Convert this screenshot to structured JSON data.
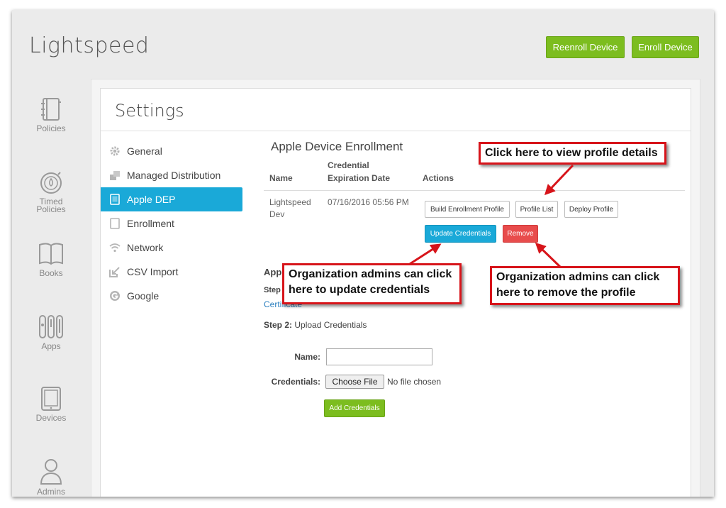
{
  "app": {
    "title": "Lightspeed"
  },
  "header": {
    "reenroll_label": "Reenroll Device",
    "enroll_label": "Enroll Device"
  },
  "nav": {
    "policies": "Policies",
    "timed_policies_line1": "Timed",
    "timed_policies_line2": "Policies",
    "books": "Books",
    "apps": "Apps",
    "devices": "Devices",
    "admins": "Admins"
  },
  "settings": {
    "title": "Settings",
    "menu": [
      {
        "label": "General",
        "icon": "gear-icon"
      },
      {
        "label": "Managed Distribution",
        "icon": "distribution-icon"
      },
      {
        "label": "Apple DEP",
        "icon": "tablet-icon"
      },
      {
        "label": "Enrollment",
        "icon": "tablet-icon"
      },
      {
        "label": "Network",
        "icon": "wifi-icon"
      },
      {
        "label": "CSV Import",
        "icon": "import-icon"
      },
      {
        "label": "Google",
        "icon": "google-icon"
      }
    ]
  },
  "enrollment": {
    "title": "Apple Device Enrollment",
    "columns": {
      "name": "Name",
      "credential_line1": "Credential",
      "credential_line2": "Expiration Date",
      "actions": "Actions"
    },
    "row": {
      "name_line1": "Lightspeed",
      "name_line2": "Dev",
      "expiration": "07/16/2016 05:56 PM",
      "build_profile": "Build Enrollment Profile",
      "profile_list": "Profile List",
      "deploy_profile": "Deploy Profile",
      "update_credentials": "Update Credentials",
      "remove": "Remove"
    },
    "partial_heading": "App",
    "step1_label": "Step",
    "certificate_link": "Certificate",
    "step2_label": "Step 2:",
    "step2_text": "Upload Credentials",
    "name_label": "Name:",
    "name_value": "",
    "credentials_label": "Credentials:",
    "choose_file": "Choose File",
    "no_file": "No file chosen",
    "add_credentials": "Add Credentials"
  },
  "callouts": {
    "profile_details": "Click here to view profile details",
    "update_line1": "Organization admins can click",
    "update_line2": "here to update credentials",
    "remove_line1": "Organization admins can click",
    "remove_line2": "here to remove the profile"
  },
  "colors": {
    "green": "#7cbd1f",
    "blue": "#1aa9d8",
    "red": "#e84c4c",
    "callout_border": "#d7141a"
  }
}
